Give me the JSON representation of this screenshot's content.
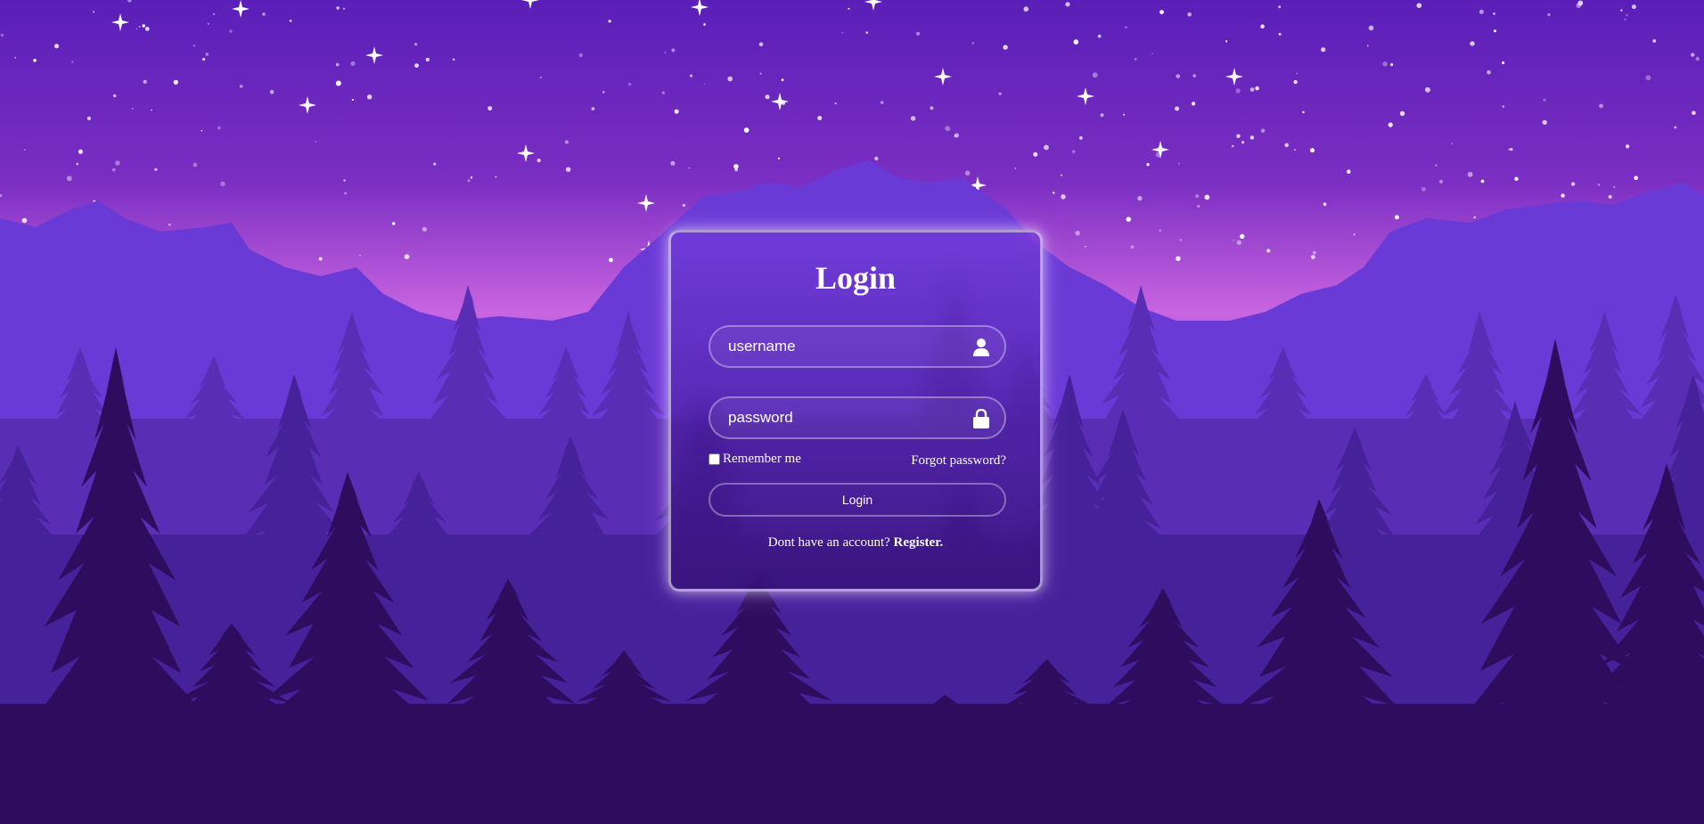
{
  "colors": {
    "sky_top": "#5a1fb8",
    "sky_horizon": "#c865e0",
    "mountain": "#6a3ad6",
    "forest_far": "#5a2db5",
    "forest_mid": "#45219a",
    "forest_near": "#2e0d5e",
    "text": "#ffffff"
  },
  "login": {
    "title": "Login",
    "username_placeholder": "username",
    "username_icon": "user-icon",
    "password_placeholder": "password",
    "password_icon": "lock-icon",
    "remember_label": "Remember me",
    "forgot_label": "Forgot password?",
    "button_label": "Login",
    "register_prompt": "Dont have an account?",
    "register_label": "Register."
  }
}
